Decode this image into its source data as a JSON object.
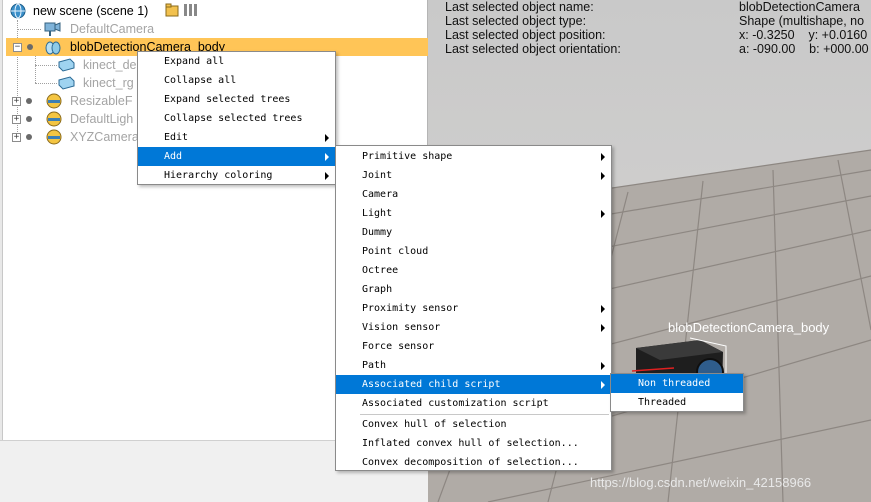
{
  "hierarchy": {
    "scene_label": "new scene (scene 1)",
    "items": [
      {
        "label": "DefaultCamera"
      },
      {
        "label": "blobDetectionCamera_body"
      },
      {
        "label": "kinect_de"
      },
      {
        "label": "kinect_rg"
      },
      {
        "label": "ResizableF"
      },
      {
        "label": "DefaultLigh"
      },
      {
        "label": "XYZCamera"
      }
    ]
  },
  "info": {
    "labels": [
      "Last selected object name:",
      "Last selected object type:",
      "Last selected object position:",
      "Last selected object orientation:"
    ],
    "values": [
      "blobDetectionCamera",
      "Shape (multishape, no",
      "x: -0.3250    y: +0.0160",
      "a: -090.00    b: +000.00"
    ]
  },
  "viewport": {
    "object_label": "blobDetectionCamera_body",
    "watermark": "https://blog.csdn.net/weixin_42158966"
  },
  "context_menu": {
    "items": [
      "Expand all",
      "Collapse all",
      "Expand selected trees",
      "Collapse selected trees",
      "Edit",
      "Add",
      "Hierarchy coloring"
    ]
  },
  "add_menu": {
    "items": [
      "Primitive shape",
      "Joint",
      "Camera",
      "Light",
      "Dummy",
      "Point cloud",
      "Octree",
      "Graph",
      "Proximity sensor",
      "Vision sensor",
      "Force sensor",
      "Path",
      "Associated child script",
      "Associated customization script",
      "Convex hull of selection",
      "Inflated convex hull of selection...",
      "Convex decomposition of selection..."
    ]
  },
  "script_menu": {
    "items": [
      "Non threaded",
      "Threaded"
    ]
  },
  "colors": {
    "selection": "#ffc557",
    "menu_highlight": "#0078d7"
  }
}
